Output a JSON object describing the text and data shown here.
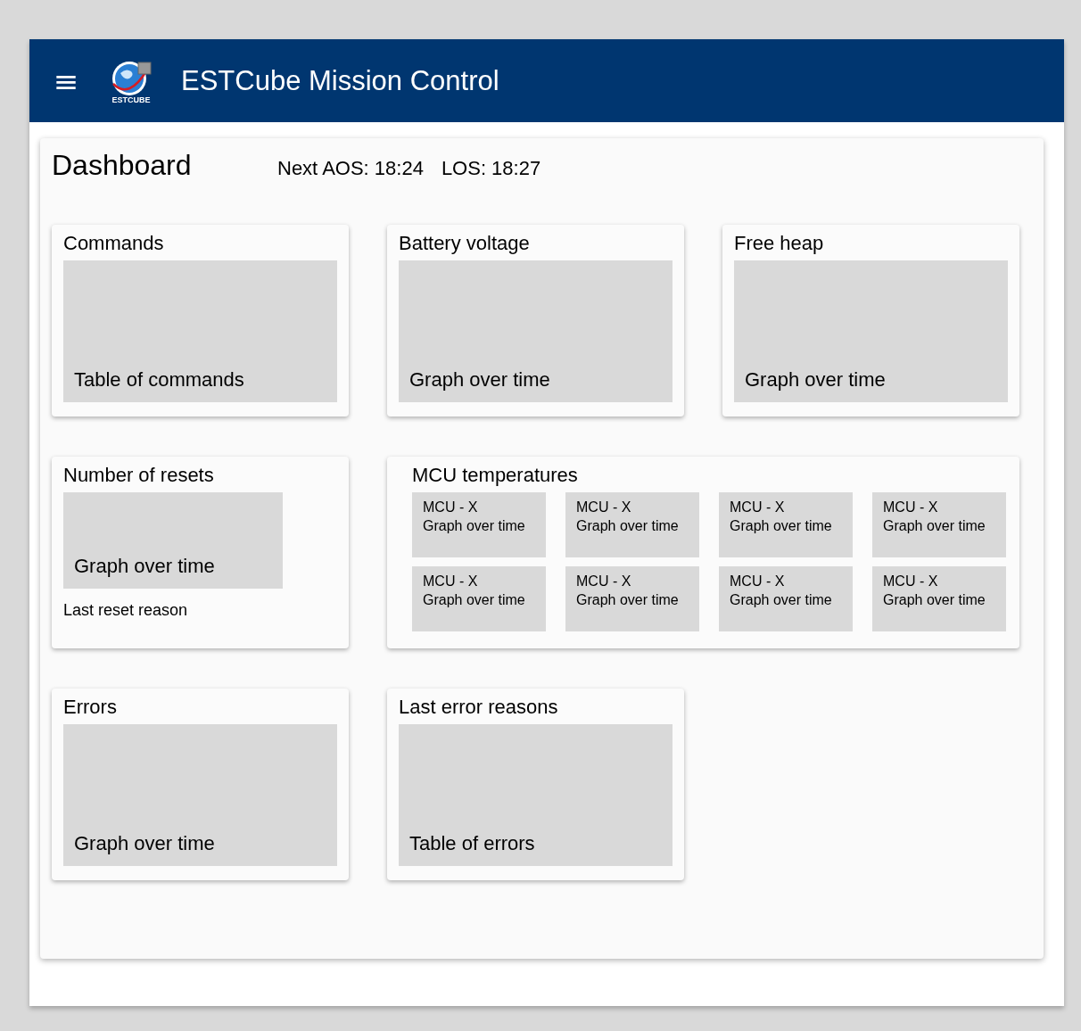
{
  "header": {
    "menu_icon": "≡",
    "logo_text": "ESTCUBE",
    "title": "ESTCube Mission Control"
  },
  "dashboard": {
    "title": "Dashboard",
    "next_aos": "Next AOS: 18:24",
    "los": "LOS: 18:27"
  },
  "widgets": [
    {
      "kind": "placeholder",
      "title": "Commands",
      "placeholder": "Table of commands"
    },
    {
      "kind": "placeholder",
      "title": "Battery voltage",
      "placeholder": "Graph over time"
    },
    {
      "kind": "placeholder",
      "title": "Free heap",
      "placeholder": "Graph over time"
    },
    {
      "kind": "resets",
      "title": "Number of resets",
      "placeholder": "Graph over time",
      "footer": "Last reset reason"
    },
    {
      "kind": "mcu",
      "title": "MCU temperatures",
      "tiles": [
        {
          "name": "MCU - X",
          "placeholder": "Graph over time"
        },
        {
          "name": "MCU - X",
          "placeholder": "Graph over time"
        },
        {
          "name": "MCU - X",
          "placeholder": "Graph over time"
        },
        {
          "name": "MCU - X",
          "placeholder": "Graph over time"
        },
        {
          "name": "MCU - X",
          "placeholder": "Graph over time"
        },
        {
          "name": "MCU - X",
          "placeholder": "Graph over time"
        },
        {
          "name": "MCU - X",
          "placeholder": "Graph over time"
        },
        {
          "name": "MCU - X",
          "placeholder": "Graph over time"
        }
      ]
    },
    {
      "kind": "placeholder",
      "title": "Errors",
      "placeholder": "Graph over time"
    },
    {
      "kind": "placeholder",
      "title": "Last error reasons",
      "placeholder": "Table of errors"
    }
  ]
}
